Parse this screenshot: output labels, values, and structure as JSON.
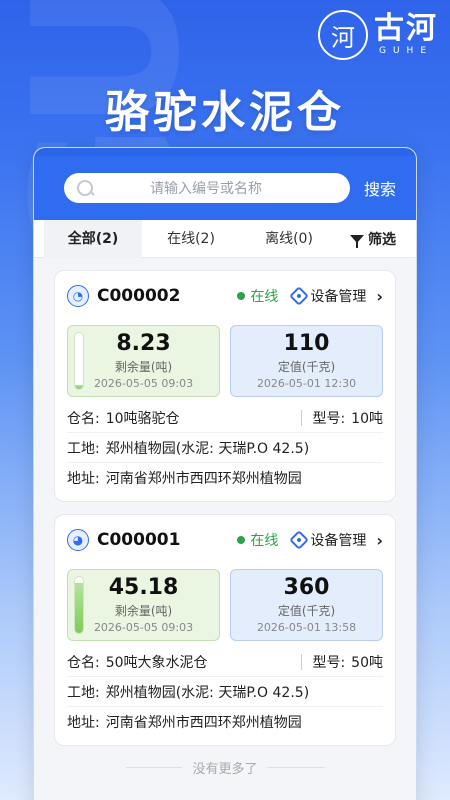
{
  "brand": {
    "seal": "河",
    "name_cn": "古河",
    "name_en": "GUHE"
  },
  "hero": {
    "title": "骆驼水泥仓"
  },
  "search": {
    "placeholder": "请输入编号或名称",
    "button": "搜索"
  },
  "tabs": [
    {
      "label": "全部(2)",
      "active": true
    },
    {
      "label": "在线(2)",
      "active": false
    },
    {
      "label": "离线(0)",
      "active": false
    }
  ],
  "filter_label": "筛选",
  "devices": [
    {
      "icon": "camel-icon",
      "id": "C000002",
      "status": "在线",
      "manage_label": "设备管理",
      "remaining": {
        "value": "8.23",
        "label": "剩余量(吨)",
        "time": "2026-05-05 09:03",
        "level": 0.08
      },
      "setpoint": {
        "value": "110",
        "label": "定值(千克)",
        "time": "2026-05-01 12:30"
      },
      "silo_key": "仓名:",
      "silo_name": "10吨骆驼仓",
      "model_key": "型号:",
      "model": "10吨",
      "site_key": "工地:",
      "site": "郑州植物园(水泥:  天瑞P.O 42.5)",
      "addr_key": "地址:",
      "address": "河南省郑州市西四环郑州植物园"
    },
    {
      "icon": "elephant-icon",
      "id": "C000001",
      "status": "在线",
      "manage_label": "设备管理",
      "remaining": {
        "value": "45.18",
        "label": "剩余量(吨)",
        "time": "2026-05-05 09:03",
        "level": 0.9
      },
      "setpoint": {
        "value": "360",
        "label": "定值(千克)",
        "time": "2026-05-01 13:58"
      },
      "silo_key": "仓名:",
      "silo_name": "50吨大象水泥仓",
      "model_key": "型号:",
      "model": "50吨",
      "site_key": "工地:",
      "site": "郑州植物园(水泥:  天瑞P.O 42.5)",
      "addr_key": "地址:",
      "address": "河南省郑州市西四环郑州植物园"
    }
  ],
  "footer_text": "没有更多了",
  "colors": {
    "primary": "#2f6cf0",
    "online": "#2ba34a",
    "remaining_bg": "#eaf6e2",
    "setpoint_bg": "#e3edfb"
  }
}
